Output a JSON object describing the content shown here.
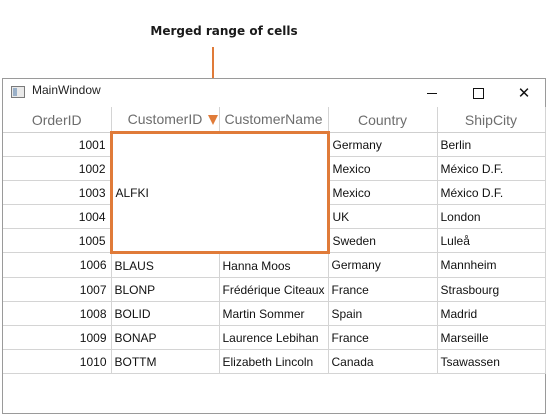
{
  "annotation": {
    "text": "Merged range of cells"
  },
  "window": {
    "title": "MainWindow"
  },
  "grid": {
    "columns": [
      "OrderID",
      "CustomerID",
      "CustomerName",
      "Country",
      "ShipCity"
    ],
    "merged": {
      "customer_id": "ALFKI"
    },
    "rows": [
      {
        "order_id": "1001",
        "customer_id": "",
        "customer_name": "",
        "country": "Germany",
        "ship_city": "Berlin"
      },
      {
        "order_id": "1002",
        "customer_id": "",
        "customer_name": "",
        "country": "Mexico",
        "ship_city": "México D.F."
      },
      {
        "order_id": "1003",
        "customer_id": "",
        "customer_name": "",
        "country": "Mexico",
        "ship_city": "México D.F."
      },
      {
        "order_id": "1004",
        "customer_id": "",
        "customer_name": "",
        "country": "UK",
        "ship_city": "London"
      },
      {
        "order_id": "1005",
        "customer_id": "",
        "customer_name": "",
        "country": "Sweden",
        "ship_city": "Luleå"
      },
      {
        "order_id": "1006",
        "customer_id": "BLAUS",
        "customer_name": "Hanna Moos",
        "country": "Germany",
        "ship_city": "Mannheim"
      },
      {
        "order_id": "1007",
        "customer_id": "BLONP",
        "customer_name": "Frédérique Citeaux",
        "country": "France",
        "ship_city": "Strasbourg"
      },
      {
        "order_id": "1008",
        "customer_id": "BOLID",
        "customer_name": "Martin Sommer",
        "country": "Spain",
        "ship_city": "Madrid"
      },
      {
        "order_id": "1009",
        "customer_id": "BONAP",
        "customer_name": "Laurence Lebihan",
        "country": "France",
        "ship_city": "Marseille"
      },
      {
        "order_id": "1010",
        "customer_id": "BOTTM",
        "customer_name": "Elizabeth Lincoln",
        "country": "Canada",
        "ship_city": "Tsawassen"
      }
    ]
  },
  "colors": {
    "highlight": "#e07b39",
    "gridline": "#d4d4d4",
    "header_text": "#6d6d6d"
  },
  "icons": {
    "window": "app-window-icon",
    "minimize": "minimize-icon",
    "maximize": "maximize-icon",
    "close": "close-icon"
  }
}
